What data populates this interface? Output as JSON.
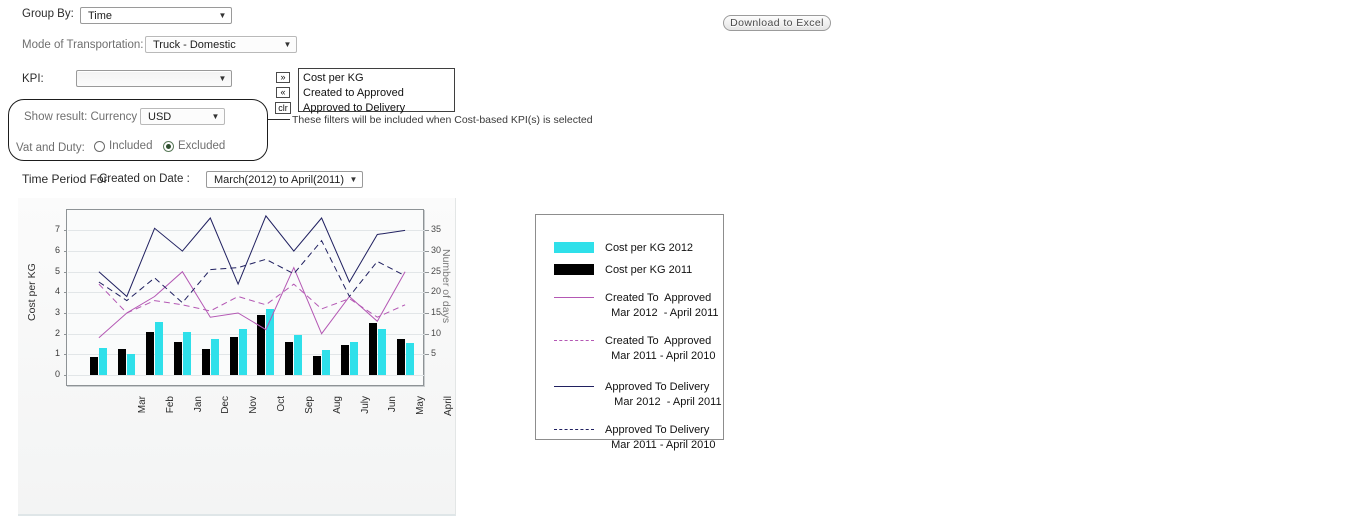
{
  "toolbar": {
    "download_label": "Download to Excel"
  },
  "filters": {
    "group_by": {
      "label": "Group By:",
      "value": "Time"
    },
    "mode_of_transportation": {
      "label": "Mode of Transportation:",
      "value": "Truck - Domestic"
    },
    "kpi": {
      "label": "KPI:",
      "value": ""
    },
    "kpi_buttons": {
      "add": "»",
      "remove": "«",
      "clear": "clr"
    },
    "kpi_options": [
      "Cost per KG",
      "Created to Approved",
      "Approved to Delivery"
    ],
    "kpi_note": "These filters will be included when Cost-based KPI(s) is selected",
    "currency": {
      "label": "Show result: Currency",
      "value": "USD"
    },
    "vat_and_duty": {
      "label": "Vat and Duty:",
      "option_included": "Included",
      "option_excluded": "Excluded",
      "selected": "Excluded"
    },
    "time_period": {
      "label_prefix": "Time Period For",
      "label_field": "Created on Date :",
      "value": "March(2012) to April(2011)"
    }
  },
  "colors": {
    "cost_2012": "#2FE0EA",
    "cost_2011": "#000000",
    "created_to_approved": "#B458B4",
    "approved_to_delivery": "#202060"
  },
  "legend": {
    "items": [
      {
        "name": "cost-per-kg-2012",
        "style": "box",
        "color": "#2FE0EA",
        "text": "Cost per KG 2012"
      },
      {
        "name": "cost-per-kg-2011",
        "style": "box",
        "color": "#000000",
        "text": "Cost per KG 2011"
      },
      {
        "name": "created-to-approved-2012",
        "style": "solid",
        "color": "#B458B4",
        "text": "Created To  Approved\n  Mar 2012  - April 2011"
      },
      {
        "name": "created-to-approved-2011",
        "style": "dashed",
        "color": "#B458B4",
        "text": "Created To  Approved\n  Mar 2011 - April 2010"
      },
      {
        "name": "approved-to-delivery-2012",
        "style": "solid",
        "color": "#202060",
        "text": "Approved To Delivery\n   Mar 2012  - April 2011"
      },
      {
        "name": "approved-to-delivery-2011",
        "style": "dashed",
        "color": "#202060",
        "text": "Approved To Delivery\n  Mar 2011 - April 2010"
      }
    ]
  },
  "chart_data": {
    "type": "bar",
    "title": "",
    "xlabel": "",
    "ylabel": "Cost per KG",
    "y2label": "Number of days",
    "ylim": [
      0,
      7.6
    ],
    "y2lim": [
      0,
      38
    ],
    "yticks": [
      0,
      1,
      2,
      3,
      4,
      5,
      6,
      7
    ],
    "y2ticks": [
      5,
      10,
      15,
      20,
      25,
      30,
      35
    ],
    "grid": true,
    "legend_position": "right",
    "categories": [
      "Mar",
      "Feb",
      "Jan",
      "Dec",
      "Nov",
      "Oct",
      "Sep",
      "Aug",
      "July",
      "Jun",
      "May",
      "April"
    ],
    "series": [
      {
        "name": "Cost per KG 2011",
        "type": "bar",
        "axis": "left",
        "color": "#000000",
        "values": [
          0.85,
          1.25,
          2.1,
          1.6,
          1.25,
          1.85,
          2.9,
          1.6,
          0.9,
          1.45,
          2.5,
          1.75
        ]
      },
      {
        "name": "Cost per KG 2012",
        "type": "bar",
        "axis": "left",
        "color": "#2FE0EA",
        "values": [
          1.3,
          1.0,
          2.55,
          2.1,
          1.75,
          2.25,
          3.2,
          1.95,
          1.2,
          1.6,
          2.25,
          1.55
        ]
      },
      {
        "name": "Created To Approved Mar 2012 - April 2011",
        "type": "line",
        "dash": "solid",
        "axis": "right",
        "color": "#B458B4",
        "values": [
          9,
          15,
          19,
          25,
          14,
          15,
          11,
          26,
          10,
          19,
          13,
          25
        ]
      },
      {
        "name": "Created To Approved Mar 2011 - April 2010",
        "type": "line",
        "dash": "dashed",
        "axis": "right",
        "color": "#B458B4",
        "values": [
          22,
          15,
          18,
          17,
          15.5,
          19,
          17,
          22,
          16,
          18.5,
          14,
          17
        ]
      },
      {
        "name": "Approved To Delivery Mar 2012 - April 2011",
        "type": "line",
        "dash": "solid",
        "axis": "right",
        "color": "#202060",
        "values": [
          25,
          19,
          35.5,
          30,
          38,
          22,
          38.5,
          30,
          38,
          22.5,
          34,
          35
        ]
      },
      {
        "name": "Approved To Delivery Mar 2011 - April 2010",
        "type": "line",
        "dash": "dashed",
        "axis": "right",
        "color": "#202060",
        "values": [
          22.5,
          18,
          23.5,
          17.5,
          25.5,
          26,
          28,
          24.5,
          32.5,
          19,
          27.5,
          24
        ]
      }
    ]
  }
}
